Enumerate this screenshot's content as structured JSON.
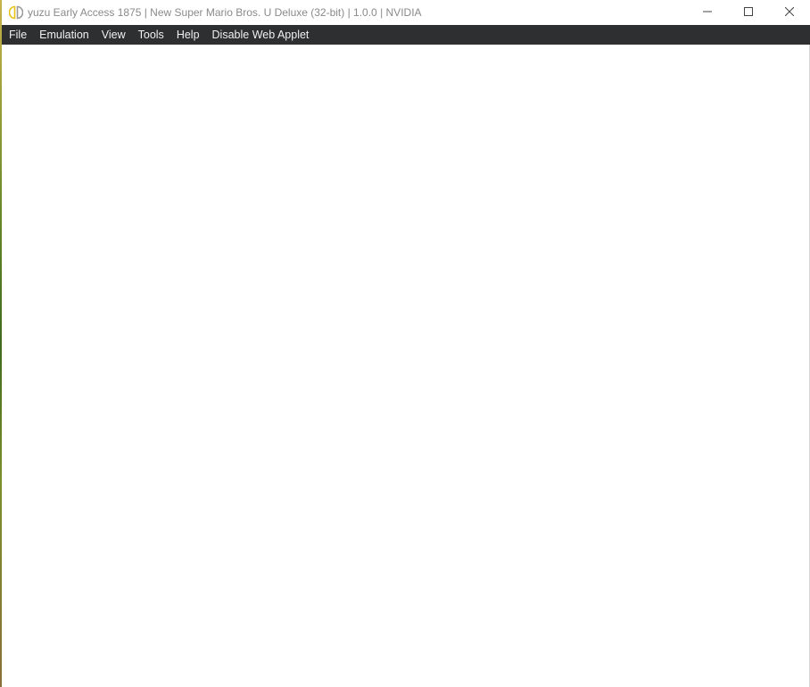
{
  "window": {
    "title": "yuzu Early Access 1875 | New Super Mario Bros. U Deluxe (32-bit) | 1.0.0 | NVIDIA",
    "app_icon": "yuzu-logo-icon",
    "controls": {
      "minimize_icon": "minimize-icon",
      "maximize_icon": "maximize-icon",
      "close_icon": "close-icon"
    }
  },
  "menubar": {
    "items": [
      {
        "label": "File"
      },
      {
        "label": "Emulation"
      },
      {
        "label": "View"
      },
      {
        "label": "Tools"
      },
      {
        "label": "Help"
      },
      {
        "label": "Disable Web Applet"
      }
    ]
  },
  "colors": {
    "menubar_bg": "#2d2f31",
    "menubar_text": "#f0f0f0",
    "title_text": "#8a8a8a",
    "render_area_bg": "#ffffff",
    "icon_accent": "#e8c21a"
  }
}
